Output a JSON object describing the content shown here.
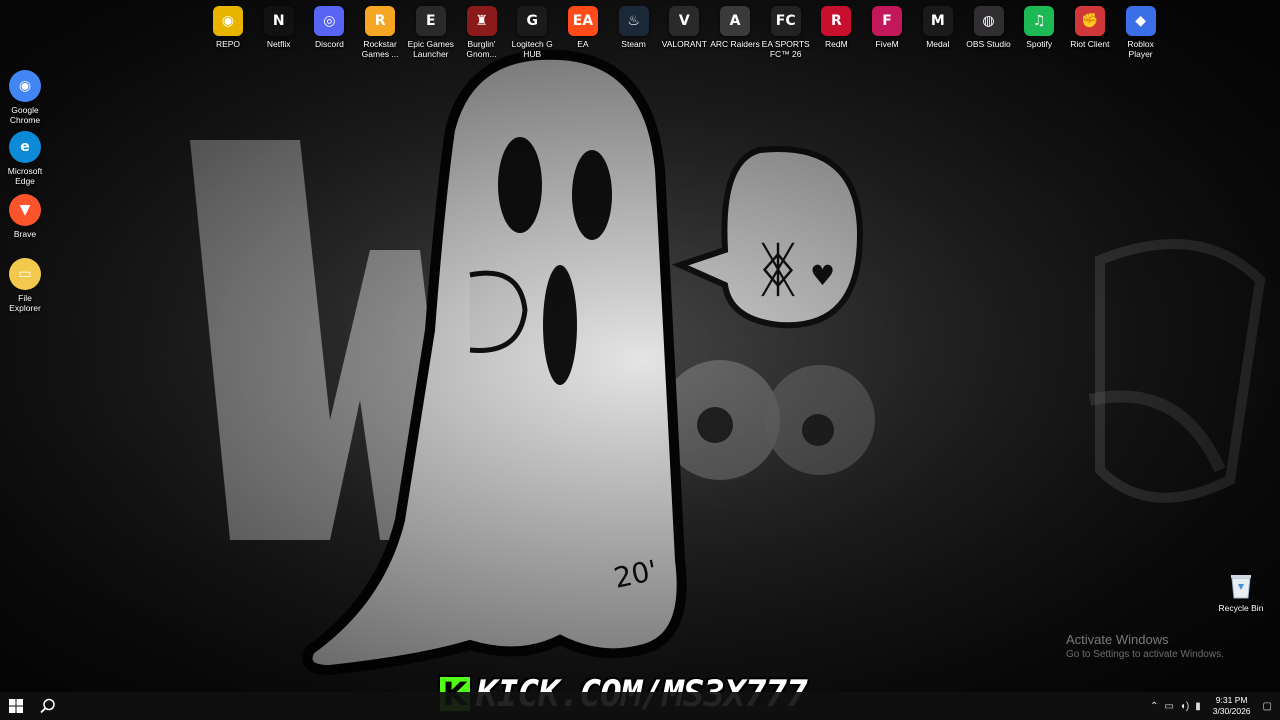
{
  "top_icons": [
    {
      "label": "REPO",
      "glyph": "◉",
      "color": "#e8b400",
      "icon": "repo-icon"
    },
    {
      "label": "Netflix",
      "glyph": "N",
      "color": "#111111",
      "icon": "netflix-icon"
    },
    {
      "label": "Discord",
      "glyph": "◎",
      "color": "#5865f2",
      "icon": "discord-icon"
    },
    {
      "label": "Rockstar Games ...",
      "glyph": "R",
      "color": "#f5a623",
      "icon": "rockstar-icon"
    },
    {
      "label": "Epic Games Launcher",
      "glyph": "E",
      "color": "#2a2a2a",
      "icon": "epic-games-icon"
    },
    {
      "label": "Burglin' Gnom...",
      "glyph": "♜",
      "color": "#8b1a1a",
      "icon": "burglin-gnomes-icon"
    },
    {
      "label": "Logitech G HUB",
      "glyph": "G",
      "color": "#1a1a1a",
      "icon": "logitech-icon"
    },
    {
      "label": "EA",
      "glyph": "EA",
      "color": "#ff4a1a",
      "icon": "ea-icon"
    },
    {
      "label": "Steam",
      "glyph": "♨",
      "color": "#1b2838",
      "icon": "steam-icon"
    },
    {
      "label": "VALORANT",
      "glyph": "V",
      "color": "#2a2a2a",
      "icon": "valorant-icon"
    },
    {
      "label": "ARC Raiders",
      "glyph": "A",
      "color": "#3a3a3a",
      "icon": "arc-raiders-icon"
    },
    {
      "label": "EA SPORTS FC™ 26",
      "glyph": "FC",
      "color": "#222222",
      "icon": "ea-sports-fc-icon"
    },
    {
      "label": "RedM",
      "glyph": "R",
      "color": "#c8102e",
      "icon": "redm-icon"
    },
    {
      "label": "FiveM",
      "glyph": "F",
      "color": "#c2185b",
      "icon": "fivem-icon"
    },
    {
      "label": "Medal",
      "glyph": "M",
      "color": "#1a1a1a",
      "icon": "medal-icon"
    },
    {
      "label": "OBS Studio",
      "glyph": "◍",
      "color": "#302e31",
      "icon": "obs-icon"
    },
    {
      "label": "Spotify",
      "glyph": "♫",
      "color": "#1db954",
      "icon": "spotify-icon"
    },
    {
      "label": "Riot Client",
      "glyph": "✊",
      "color": "#d13639",
      "icon": "riot-client-icon"
    },
    {
      "label": "Roblox Player",
      "glyph": "◆",
      "color": "#3a6fe8",
      "icon": "roblox-icon"
    }
  ],
  "left_icons": [
    {
      "label": "Google Chrome",
      "glyph": "◉",
      "color": "#4285f4",
      "icon": "chrome-icon"
    },
    {
      "label": "Microsoft Edge",
      "glyph": "e",
      "color": "#0c8ad8",
      "icon": "edge-icon"
    },
    {
      "label": "Brave",
      "glyph": "▼",
      "color": "#fb542b",
      "icon": "brave-icon"
    },
    {
      "label": "File Explorer",
      "glyph": "▭",
      "color": "#f2c94c",
      "icon": "file-explorer-icon"
    }
  ],
  "recycle_bin": {
    "label": "Recycle Bin"
  },
  "watermark": {
    "title": "Activate Windows",
    "subtitle": "Go to Settings to activate Windows."
  },
  "kick": {
    "logo": "K",
    "text": "KICK.COM/MS3X777"
  },
  "taskbar": {
    "time": "9:31 PM",
    "date": "3/30/2026"
  }
}
